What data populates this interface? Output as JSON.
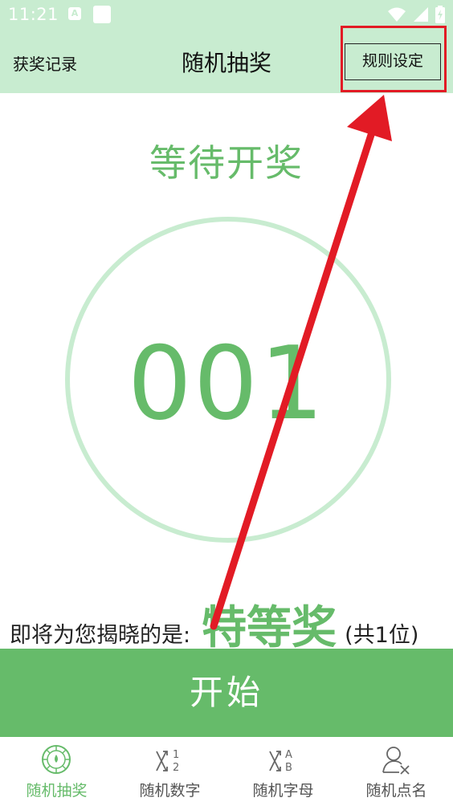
{
  "status_bar": {
    "time": "11:21",
    "notification_badge": "A",
    "icons": [
      "wifi-icon",
      "signal-icon",
      "battery-icon"
    ]
  },
  "header": {
    "records_label": "获奖记录",
    "title": "随机抽奖",
    "rules_label": "规则设定"
  },
  "main": {
    "status_heading": "等待开奖",
    "draw_number": "001",
    "reveal_label": "即将为您揭晓的是:",
    "prize_name": "特等奖",
    "prize_count": "(共1位)",
    "start_label": "开始"
  },
  "bottom_nav": {
    "items": [
      {
        "label": "随机抽奖",
        "icon": "wheel-icon",
        "active": true
      },
      {
        "label": "随机数字",
        "icon": "random-number-icon",
        "active": false
      },
      {
        "label": "随机字母",
        "icon": "random-letter-icon",
        "active": false
      },
      {
        "label": "随机点名",
        "icon": "random-person-icon",
        "active": false
      }
    ]
  },
  "colors": {
    "header_bg": "#c8ecd0",
    "accent": "#66bb6a",
    "annotation": "#e21b25"
  }
}
